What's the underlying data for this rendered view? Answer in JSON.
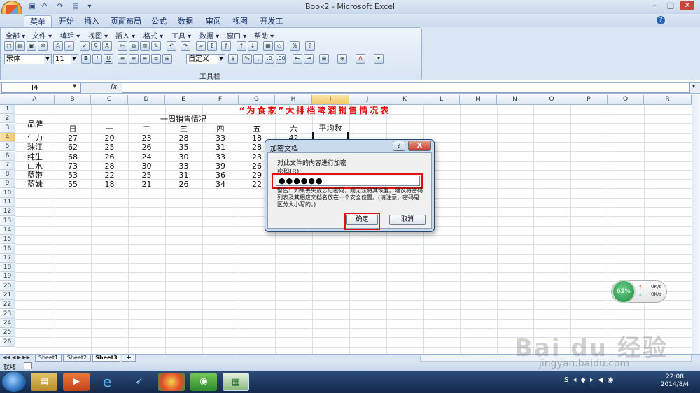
{
  "window": {
    "title": "Book2 - Microsoft Excel",
    "qa_icons": [
      "save-icon",
      "undo-icon",
      "redo-icon",
      "open-icon",
      "customize-icon"
    ],
    "controls": [
      "–",
      "□",
      "✕"
    ]
  },
  "ribbon": {
    "tabs": [
      "菜单",
      "开始",
      "插入",
      "页面布局",
      "公式",
      "数据",
      "审阅",
      "视图",
      "开发工具"
    ],
    "active_tab": "菜单",
    "menu_items": [
      "全部 ▾",
      "文件 ▾",
      "编辑 ▾",
      "视图 ▾",
      "插入 ▾",
      "格式 ▾",
      "工具 ▾",
      "数据 ▾",
      "窗口 ▾",
      "帮助 ▾"
    ],
    "font_name": "宋体",
    "font_size": "11",
    "number_format": "自定义",
    "group_label": "工具栏"
  },
  "formula_bar": {
    "name_box": "I4",
    "fx": "fx",
    "value": ""
  },
  "grid": {
    "columns": [
      "A",
      "B",
      "C",
      "D",
      "E",
      "F",
      "G",
      "H",
      "I",
      "J",
      "K",
      "L",
      "M",
      "N",
      "O",
      "P",
      "Q",
      "R"
    ],
    "rows": [
      "1",
      "2",
      "3",
      "4",
      "5",
      "6",
      "7",
      "8",
      "9",
      "10",
      "11",
      "12",
      "13",
      "14",
      "15",
      "16",
      "17",
      "18",
      "19",
      "20",
      "21",
      "22",
      "23",
      "24",
      "25",
      "26"
    ],
    "sheet_title": "“为食家”大排档啤酒销售情况表",
    "week_header": "一周销售情况",
    "brand_header": "品牌",
    "day_headers": [
      "日",
      "一",
      "二",
      "三",
      "四",
      "五",
      "六"
    ],
    "average_header": "平均数",
    "brands": [
      {
        "name": "生力",
        "values": [
          "27",
          "20",
          "23",
          "28",
          "33",
          "18",
          "42"
        ]
      },
      {
        "name": "珠江",
        "values": [
          "62",
          "25",
          "26",
          "35",
          "31",
          "28",
          ""
        ]
      },
      {
        "name": "纯生",
        "values": [
          "68",
          "26",
          "24",
          "30",
          "33",
          "23",
          ""
        ]
      },
      {
        "name": "山水",
        "values": [
          "73",
          "28",
          "30",
          "33",
          "39",
          "26",
          ""
        ]
      },
      {
        "name": "蓝带",
        "values": [
          "53",
          "22",
          "25",
          "31",
          "36",
          "29",
          ""
        ]
      },
      {
        "name": "蓝妹",
        "values": [
          "55",
          "18",
          "21",
          "26",
          "34",
          "22",
          ""
        ]
      }
    ]
  },
  "sheets": [
    "Sheet1",
    "Sheet2",
    "Sheet3"
  ],
  "active_sheet": "Sheet3",
  "status": "就绪",
  "dialog": {
    "title": "加密文档",
    "help": "?",
    "close": "X",
    "heading": "对此文件的内容进行加密",
    "password_label": "密码(R):",
    "password_value": "●●●●●●",
    "warning": "警告：如果丢失或忘记密码，则无法将其恢复。建议将密码列表及其相应文档名放在一个安全位置。(请注意，密码是区分大小写的。)",
    "ok_label": "确定",
    "cancel_label": "取消"
  },
  "net_widget": {
    "percent": "62%",
    "up": "0K/s",
    "down": "0K/s"
  },
  "taskbar": {
    "time": "22:08",
    "date": "2014/8/4"
  },
  "watermark": {
    "main": "Bai du 经验",
    "url": "jingyan.baidu.com"
  }
}
